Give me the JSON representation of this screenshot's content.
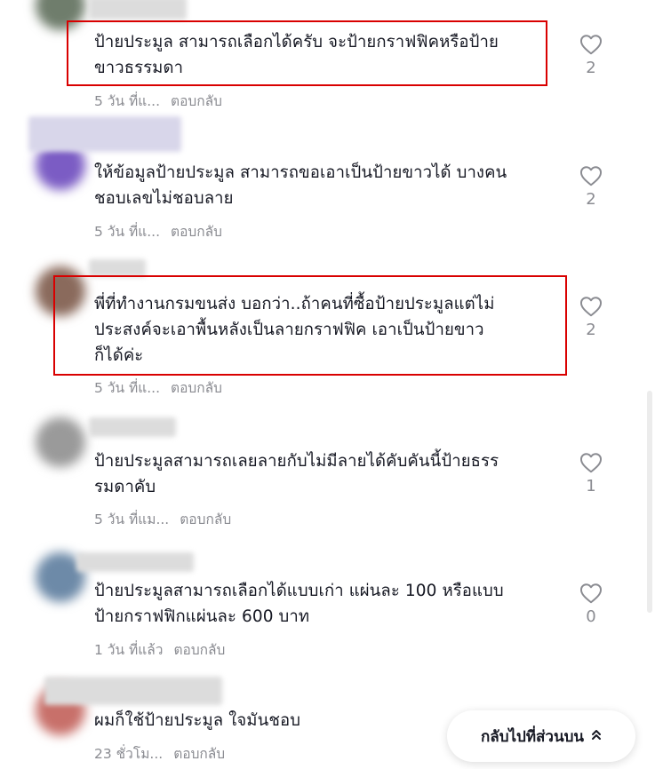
{
  "comments": [
    {
      "text": "ป้ายประมูล สามารถเลือกได้ครับ จะป้ายกราฟฟิคหรือป้าย\nขาวธรรมดา",
      "time": "5 วัน ที่แ...",
      "reply_label": "ตอบกลับ",
      "likes": "2",
      "avatar_color": "#6f7d6c",
      "highlighted": true
    },
    {
      "text": "ให้ข้อมูลป้ายประมูล สามารถขอเอาเป็นป้ายขาวได้ บางคน\nชอบเลขไม่ชอบลาย",
      "time": "5 วัน ที่แ...",
      "reply_label": "ตอบกลับ",
      "likes": "2",
      "avatar_color": "#7b5cc4",
      "highlighted": false
    },
    {
      "text": "พี่ที่ทำงานกรมขนส่ง บอกว่า..ถ้าคนที่ซื้อป้ายประมูลแต่ไม่\nประสงค์จะเอาพื้นหลังเป็นลายกราฟฟิค เอาเป็นป้ายขาว\nก็ได้ค่ะ",
      "time": "5 วัน ที่แ...",
      "reply_label": "ตอบกลับ",
      "likes": "2",
      "avatar_color": "#8a6a5c",
      "highlighted": true
    },
    {
      "text": "ป้ายประมูลสามารถเลยลายกับไม่มีลายได้คับคันนี้ป้ายธรร\nรมดาคับ",
      "time": "5 วัน ที่แม...",
      "reply_label": "ตอบกลับ",
      "likes": "1",
      "avatar_color": "#9a9a9a",
      "highlighted": false
    },
    {
      "text": "ป้ายประมูลสามารถเลือกได้แบบเก่า แผ่นละ 100 หรือแบบ\nป้ายกราฟฟิกแผ่นละ 600 บาท",
      "time": "1 วัน ที่แล้ว",
      "reply_label": "ตอบกลับ",
      "likes": "0",
      "avatar_color": "#6d8aa8",
      "highlighted": false
    },
    {
      "text": "ผมก็ใช้ป้ายประมูล ใจมันชอบ",
      "time": "23 ชั่วโม...",
      "reply_label": "ตอบกลับ",
      "likes": "",
      "avatar_color": "#c8706a",
      "highlighted": false
    }
  ],
  "back_to_top": {
    "label": "กลับไปที่ส่วนบน",
    "icon": "double-chevron-up-icon"
  },
  "colors": {
    "highlight": "#d90000",
    "muted": "#8a8b91",
    "text": "#161823"
  }
}
